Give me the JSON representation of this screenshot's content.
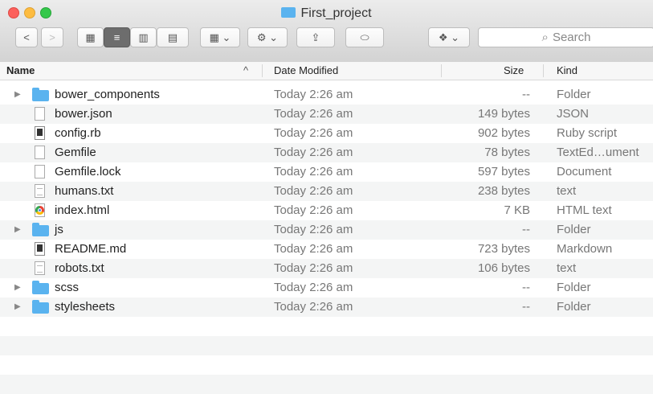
{
  "window": {
    "title": "First_project",
    "search_placeholder": "Search"
  },
  "toolbar": {
    "back_label": "<",
    "forward_label": ">",
    "view_icon_label": "▦",
    "view_list_label": "≡",
    "view_column_label": "▥",
    "view_coverflow_label": "▤",
    "arrange_label": "▦ ⌄",
    "action_label": "⚙ ⌄",
    "share_label": "⇪",
    "tag_label": "⬭",
    "dropbox_label": "❖ ⌄",
    "search_icon": "⌕"
  },
  "columns": {
    "name": "Name",
    "sort_indicator": "^",
    "date": "Date Modified",
    "size": "Size",
    "kind": "Kind"
  },
  "files": [
    {
      "disclosure": "▶",
      "name": "bower_components",
      "date": "Today 2:26 am",
      "size": "--",
      "kind": "Folder"
    },
    {
      "disclosure": "",
      "name": "bower.json",
      "date": "Today 2:26 am",
      "size": "149 bytes",
      "kind": "JSON"
    },
    {
      "disclosure": "",
      "name": "config.rb",
      "date": "Today 2:26 am",
      "size": "902 bytes",
      "kind": "Ruby script"
    },
    {
      "disclosure": "",
      "name": "Gemfile",
      "date": "Today 2:26 am",
      "size": "78 bytes",
      "kind": "TextEd…ument"
    },
    {
      "disclosure": "",
      "name": "Gemfile.lock",
      "date": "Today 2:26 am",
      "size": "597 bytes",
      "kind": "Document"
    },
    {
      "disclosure": "",
      "name": "humans.txt",
      "date": "Today 2:26 am",
      "size": "238 bytes",
      "kind": "text"
    },
    {
      "disclosure": "",
      "name": "index.html",
      "date": "Today 2:26 am",
      "size": "7 KB",
      "kind": "HTML text"
    },
    {
      "disclosure": "▶",
      "name": "js",
      "date": "Today 2:26 am",
      "size": "--",
      "kind": "Folder"
    },
    {
      "disclosure": "",
      "name": "README.md",
      "date": "Today 2:26 am",
      "size": "723 bytes",
      "kind": "Markdown"
    },
    {
      "disclosure": "",
      "name": "robots.txt",
      "date": "Today 2:26 am",
      "size": "106 bytes",
      "kind": "text"
    },
    {
      "disclosure": "▶",
      "name": "scss",
      "date": "Today 2:26 am",
      "size": "--",
      "kind": "Folder"
    },
    {
      "disclosure": "▶",
      "name": "stylesheets",
      "date": "Today 2:26 am",
      "size": "--",
      "kind": "Folder"
    }
  ]
}
